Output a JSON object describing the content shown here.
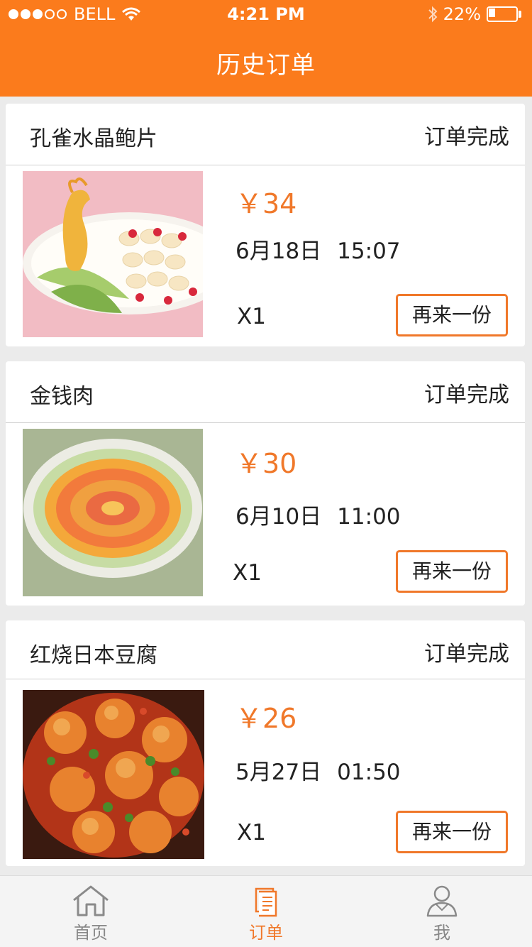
{
  "status_bar": {
    "carrier": "BELL",
    "time": "4:21 PM",
    "battery": "22%",
    "signal_bars_filled": 3,
    "signal_bars_total": 5
  },
  "header": {
    "title": "历史订单",
    "background_color": "#fb7b1c"
  },
  "orders": [
    {
      "dish_name": "孔雀水晶鲍片",
      "status": "订单完成",
      "price": "￥34",
      "date": "6月18日",
      "time": "15:07",
      "quantity": "X1",
      "reorder_label": "再来一份"
    },
    {
      "dish_name": "金钱肉",
      "status": "订单完成",
      "price": "￥30",
      "date": "6月10日",
      "time": "11:00",
      "quantity": "X1",
      "reorder_label": "再来一份"
    },
    {
      "dish_name": "红烧日本豆腐",
      "status": "订单完成",
      "price": "￥26",
      "date": "5月27日",
      "time": "01:50",
      "quantity": "X1",
      "reorder_label": "再来一份"
    }
  ],
  "tabbar": {
    "items": [
      {
        "label": "首页",
        "icon": "home-icon"
      },
      {
        "label": "订单",
        "icon": "order-document-icon",
        "active": true
      },
      {
        "label": "我",
        "icon": "user-icon"
      }
    ]
  },
  "colors": {
    "accent": "#f0782a",
    "background": "#ebebeb"
  }
}
